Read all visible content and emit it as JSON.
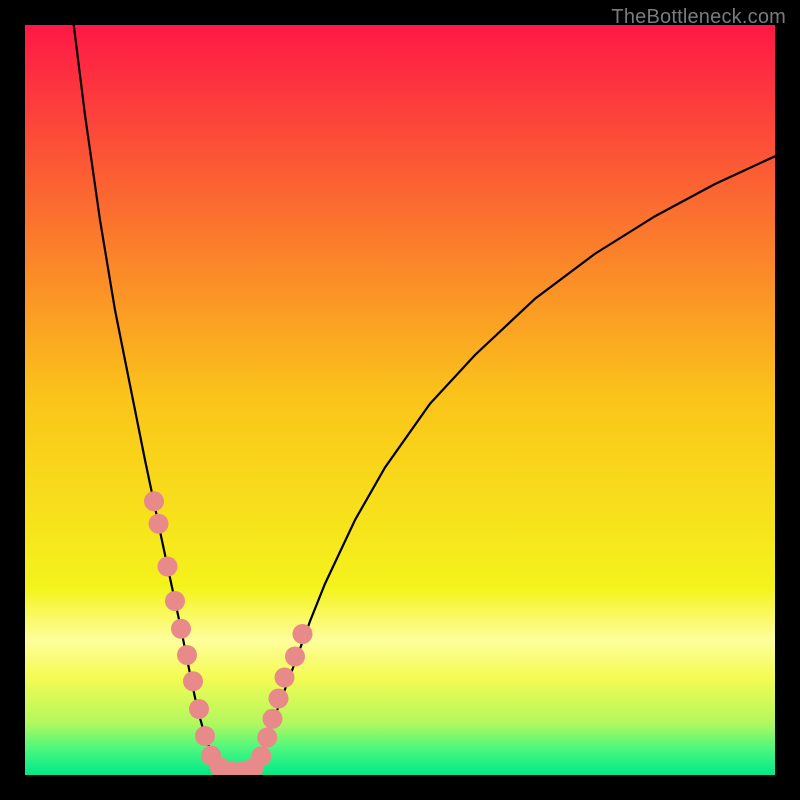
{
  "watermark": "TheBottleneck.com",
  "chart_data": {
    "type": "line",
    "title": "",
    "xlabel": "",
    "ylabel": "",
    "xlim": [
      0,
      100
    ],
    "ylim": [
      0,
      100
    ],
    "legend": null,
    "annotations": [],
    "background_gradient": {
      "direction": "vertical",
      "stops": [
        {
          "pos": 0.0,
          "color": "#fe1846"
        },
        {
          "pos": 0.25,
          "color": "#fb6f2f"
        },
        {
          "pos": 0.5,
          "color": "#fbc51a"
        },
        {
          "pos": 0.75,
          "color": "#f4f31c"
        },
        {
          "pos": 0.82,
          "color": "#fefe9c"
        },
        {
          "pos": 0.87,
          "color": "#f4fb52"
        },
        {
          "pos": 0.93,
          "color": "#b3f85e"
        },
        {
          "pos": 0.965,
          "color": "#4cf77e"
        },
        {
          "pos": 1.0,
          "color": "#00e989"
        }
      ]
    },
    "series": [
      {
        "name": "left-curve",
        "style": "solid",
        "color": "#000000",
        "x": [
          6.5,
          8,
          10,
          12,
          14,
          16,
          18,
          19,
          20,
          20.8,
          21.5,
          22.2,
          23,
          24,
          25,
          26,
          27
        ],
        "y": [
          100,
          88,
          74,
          62,
          52,
          42,
          32.5,
          27.8,
          23.2,
          19.5,
          16,
          12.5,
          8.8,
          5.2,
          2.6,
          1.0,
          0.5
        ]
      },
      {
        "name": "right-curve",
        "style": "solid",
        "color": "#000000",
        "x": [
          30,
          31,
          32,
          33,
          34.5,
          36,
          38,
          40,
          44,
          48,
          54,
          60,
          68,
          76,
          84,
          92,
          100
        ],
        "y": [
          0.5,
          1.8,
          4.0,
          7.0,
          11.0,
          15.0,
          20.5,
          25.5,
          34.0,
          41.0,
          49.5,
          56.0,
          63.5,
          69.5,
          74.5,
          78.8,
          82.5
        ]
      },
      {
        "name": "marker-dots",
        "style": "points",
        "color": "#e98a8a",
        "x": [
          17.2,
          17.8,
          19.0,
          20.0,
          20.8,
          21.6,
          22.4,
          23.2,
          24.0,
          24.8,
          26.0,
          27.5,
          29.0,
          30.5,
          31.5,
          32.3,
          33.0,
          33.8,
          34.6,
          36.0,
          37.0
        ],
        "y": [
          36.5,
          33.5,
          27.8,
          23.2,
          19.5,
          16.0,
          12.5,
          8.8,
          5.2,
          2.6,
          1.0,
          0.5,
          0.5,
          1.0,
          2.5,
          5.0,
          7.5,
          10.2,
          13.0,
          15.8,
          18.8
        ]
      }
    ]
  }
}
